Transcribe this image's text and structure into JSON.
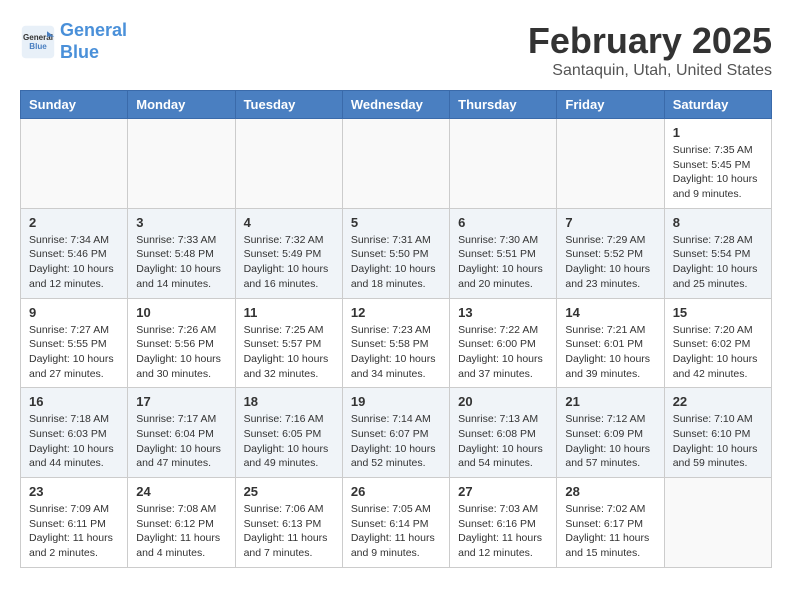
{
  "header": {
    "logo_line1": "General",
    "logo_line2": "Blue",
    "month": "February 2025",
    "location": "Santaquin, Utah, United States"
  },
  "weekdays": [
    "Sunday",
    "Monday",
    "Tuesday",
    "Wednesday",
    "Thursday",
    "Friday",
    "Saturday"
  ],
  "weeks": [
    [
      {
        "day": "",
        "info": ""
      },
      {
        "day": "",
        "info": ""
      },
      {
        "day": "",
        "info": ""
      },
      {
        "day": "",
        "info": ""
      },
      {
        "day": "",
        "info": ""
      },
      {
        "day": "",
        "info": ""
      },
      {
        "day": "1",
        "info": "Sunrise: 7:35 AM\nSunset: 5:45 PM\nDaylight: 10 hours and 9 minutes."
      }
    ],
    [
      {
        "day": "2",
        "info": "Sunrise: 7:34 AM\nSunset: 5:46 PM\nDaylight: 10 hours and 12 minutes."
      },
      {
        "day": "3",
        "info": "Sunrise: 7:33 AM\nSunset: 5:48 PM\nDaylight: 10 hours and 14 minutes."
      },
      {
        "day": "4",
        "info": "Sunrise: 7:32 AM\nSunset: 5:49 PM\nDaylight: 10 hours and 16 minutes."
      },
      {
        "day": "5",
        "info": "Sunrise: 7:31 AM\nSunset: 5:50 PM\nDaylight: 10 hours and 18 minutes."
      },
      {
        "day": "6",
        "info": "Sunrise: 7:30 AM\nSunset: 5:51 PM\nDaylight: 10 hours and 20 minutes."
      },
      {
        "day": "7",
        "info": "Sunrise: 7:29 AM\nSunset: 5:52 PM\nDaylight: 10 hours and 23 minutes."
      },
      {
        "day": "8",
        "info": "Sunrise: 7:28 AM\nSunset: 5:54 PM\nDaylight: 10 hours and 25 minutes."
      }
    ],
    [
      {
        "day": "9",
        "info": "Sunrise: 7:27 AM\nSunset: 5:55 PM\nDaylight: 10 hours and 27 minutes."
      },
      {
        "day": "10",
        "info": "Sunrise: 7:26 AM\nSunset: 5:56 PM\nDaylight: 10 hours and 30 minutes."
      },
      {
        "day": "11",
        "info": "Sunrise: 7:25 AM\nSunset: 5:57 PM\nDaylight: 10 hours and 32 minutes."
      },
      {
        "day": "12",
        "info": "Sunrise: 7:23 AM\nSunset: 5:58 PM\nDaylight: 10 hours and 34 minutes."
      },
      {
        "day": "13",
        "info": "Sunrise: 7:22 AM\nSunset: 6:00 PM\nDaylight: 10 hours and 37 minutes."
      },
      {
        "day": "14",
        "info": "Sunrise: 7:21 AM\nSunset: 6:01 PM\nDaylight: 10 hours and 39 minutes."
      },
      {
        "day": "15",
        "info": "Sunrise: 7:20 AM\nSunset: 6:02 PM\nDaylight: 10 hours and 42 minutes."
      }
    ],
    [
      {
        "day": "16",
        "info": "Sunrise: 7:18 AM\nSunset: 6:03 PM\nDaylight: 10 hours and 44 minutes."
      },
      {
        "day": "17",
        "info": "Sunrise: 7:17 AM\nSunset: 6:04 PM\nDaylight: 10 hours and 47 minutes."
      },
      {
        "day": "18",
        "info": "Sunrise: 7:16 AM\nSunset: 6:05 PM\nDaylight: 10 hours and 49 minutes."
      },
      {
        "day": "19",
        "info": "Sunrise: 7:14 AM\nSunset: 6:07 PM\nDaylight: 10 hours and 52 minutes."
      },
      {
        "day": "20",
        "info": "Sunrise: 7:13 AM\nSunset: 6:08 PM\nDaylight: 10 hours and 54 minutes."
      },
      {
        "day": "21",
        "info": "Sunrise: 7:12 AM\nSunset: 6:09 PM\nDaylight: 10 hours and 57 minutes."
      },
      {
        "day": "22",
        "info": "Sunrise: 7:10 AM\nSunset: 6:10 PM\nDaylight: 10 hours and 59 minutes."
      }
    ],
    [
      {
        "day": "23",
        "info": "Sunrise: 7:09 AM\nSunset: 6:11 PM\nDaylight: 11 hours and 2 minutes."
      },
      {
        "day": "24",
        "info": "Sunrise: 7:08 AM\nSunset: 6:12 PM\nDaylight: 11 hours and 4 minutes."
      },
      {
        "day": "25",
        "info": "Sunrise: 7:06 AM\nSunset: 6:13 PM\nDaylight: 11 hours and 7 minutes."
      },
      {
        "day": "26",
        "info": "Sunrise: 7:05 AM\nSunset: 6:14 PM\nDaylight: 11 hours and 9 minutes."
      },
      {
        "day": "27",
        "info": "Sunrise: 7:03 AM\nSunset: 6:16 PM\nDaylight: 11 hours and 12 minutes."
      },
      {
        "day": "28",
        "info": "Sunrise: 7:02 AM\nSunset: 6:17 PM\nDaylight: 11 hours and 15 minutes."
      },
      {
        "day": "",
        "info": ""
      }
    ]
  ]
}
